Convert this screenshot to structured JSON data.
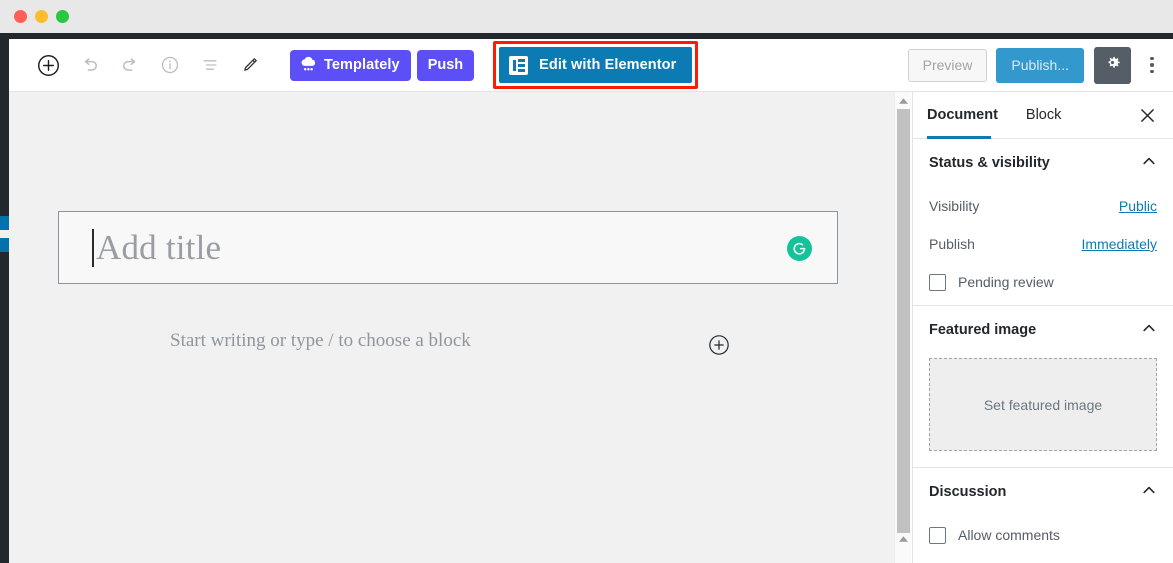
{
  "window": {
    "traffic_lights": [
      "close",
      "minimize",
      "zoom"
    ],
    "colors": {
      "close": "#ff5f57",
      "minimize": "#febc2e",
      "zoom": "#28c840"
    }
  },
  "toolbar": {
    "icons": [
      {
        "name": "add-block-icon",
        "title": "Add block"
      },
      {
        "name": "undo-icon",
        "title": "Undo"
      },
      {
        "name": "redo-icon",
        "title": "Redo"
      },
      {
        "name": "info-icon",
        "title": "Content structure"
      },
      {
        "name": "block-navigation-icon",
        "title": "Block navigation"
      },
      {
        "name": "pencil-icon",
        "title": "Edit"
      }
    ],
    "templately_label": "Templately",
    "push_label": "Push",
    "elementor_label": "Edit with Elementor",
    "preview_label": "Preview",
    "publish_label": "Publish...",
    "settings_gear": "gear-icon",
    "more_menu": "kebab-menu-icon",
    "highlight_color": "#f81d04",
    "elementor_color": "#0c7bb3",
    "templately_color": "#5b4ff5",
    "publish_color": "#3399cc"
  },
  "editor": {
    "title_placeholder": "Add title",
    "title_value": "",
    "block_placeholder": "Start writing or type / to choose a block",
    "grammarly_badge": "grammarly-icon",
    "grammarly_color": "#15c39a",
    "inserter_icon": "plus-circle-icon"
  },
  "sidebar": {
    "tabs": [
      {
        "label": "Document",
        "active": true
      },
      {
        "label": "Block",
        "active": false
      }
    ],
    "close_label": "Close settings",
    "sections": [
      {
        "title": "Status & visibility",
        "rows": [
          {
            "key": "Visibility",
            "value": "Public"
          },
          {
            "key": "Publish",
            "value": "Immediately"
          }
        ],
        "checkbox": {
          "label": "Pending review",
          "checked": false
        }
      },
      {
        "title": "Featured image",
        "drop_label": "Set featured image"
      },
      {
        "title": "Discussion",
        "checkbox": {
          "label": "Allow comments",
          "checked": false
        }
      }
    ],
    "accent": "#0c7bb3"
  }
}
